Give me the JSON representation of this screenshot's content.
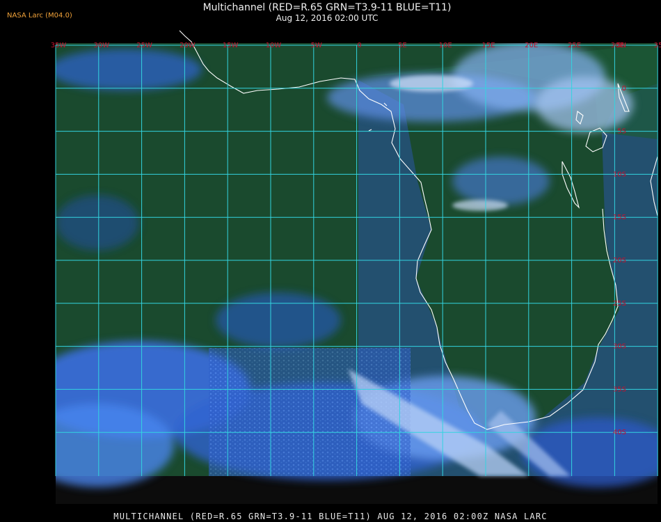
{
  "org_label": "NASA Larc (M04.0)",
  "title_line1": "Multichannel (RED=R.65 GRN=T3.9-11 BLUE=T11)",
  "title_line2": "Aug 12, 2016 02:00 UTC",
  "footer": "MULTICHANNEL (RED=R.65 GRN=T3.9-11 BLUE=T11) AUG 12, 2016 02:00Z   NASA LARC",
  "colors": {
    "grid": "#33d4e0",
    "labels": "#c8102e",
    "coast": "#ffffff"
  },
  "longitudes": [
    {
      "label": "35W",
      "value": -35
    },
    {
      "label": "30W",
      "value": -30
    },
    {
      "label": "25W",
      "value": -25
    },
    {
      "label": "20W",
      "value": -20
    },
    {
      "label": "15W",
      "value": -15
    },
    {
      "label": "10W",
      "value": -10
    },
    {
      "label": "5W",
      "value": -5
    },
    {
      "label": "0",
      "value": 0
    },
    {
      "label": "5E",
      "value": 5
    },
    {
      "label": "10E",
      "value": 10
    },
    {
      "label": "15E",
      "value": 15
    },
    {
      "label": "20E",
      "value": 20
    },
    {
      "label": "25E",
      "value": 25
    },
    {
      "label": "30E",
      "value": 30
    },
    {
      "label": "35E",
      "value": 35
    }
  ],
  "latitudes": [
    {
      "label": "5N",
      "value": 5
    },
    {
      "label": "0",
      "value": 0
    },
    {
      "label": "5S",
      "value": -5
    },
    {
      "label": "10S",
      "value": -10
    },
    {
      "label": "15S",
      "value": -15
    },
    {
      "label": "20S",
      "value": -20
    },
    {
      "label": "25S",
      "value": -25
    },
    {
      "label": "30S",
      "value": -30
    },
    {
      "label": "35S",
      "value": -35
    },
    {
      "label": "40S",
      "value": -40
    }
  ]
}
